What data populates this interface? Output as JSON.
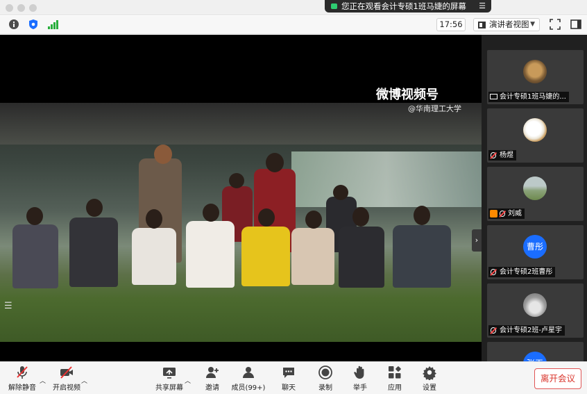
{
  "banner": {
    "text": "您正在观看会计专硕1班马婕的屏幕"
  },
  "topbar": {
    "time": "17:56",
    "view_label": "演讲者视图"
  },
  "video": {
    "watermark": "微博视频号",
    "watermark_sub": "@华南理工大学"
  },
  "participants": [
    {
      "name": "会计专硕1班马婕的...",
      "avatar": "dog-photo",
      "status": "sharing"
    },
    {
      "name": "杨煜",
      "avatar": "cartoon-photo",
      "status": "muted"
    },
    {
      "name": "刘威",
      "avatar": "landscape-photo",
      "status": "muted"
    },
    {
      "name": "会计专硕2班曹彤",
      "avatar_text": "曹彤",
      "avatar_color": "#1a6dff",
      "status": "muted"
    },
    {
      "name": "会计专硕2班-卢星宇",
      "avatar": "sky-photo",
      "status": "muted"
    },
    {
      "name": "",
      "avatar_text": "张玉",
      "avatar_color": "#1a6dff",
      "status": "muted"
    }
  ],
  "toolbar": {
    "unmute": "解除静音",
    "start_video": "开启视频",
    "share_screen": "共享屏幕",
    "invite": "邀请",
    "members": "成员(99+)",
    "chat": "聊天",
    "record": "录制",
    "raise_hand": "举手",
    "apps": "应用",
    "settings": "设置",
    "leave": "离开会议"
  },
  "colors": {
    "accent": "#1a6dff",
    "leave": "#d9342b",
    "share_dot": "#2ecc71"
  }
}
